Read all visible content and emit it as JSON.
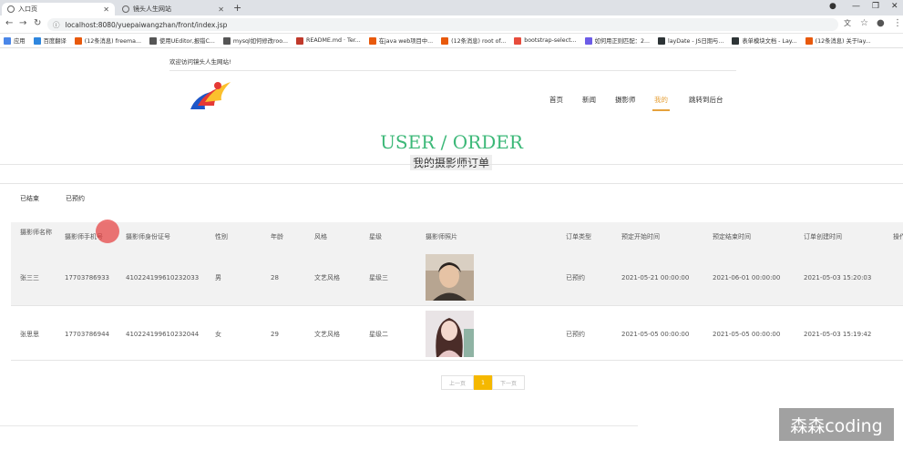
{
  "browser": {
    "tabs": [
      {
        "title": "入口页"
      },
      {
        "title": "镜头人生网站"
      }
    ],
    "new_tab": "+",
    "url": "localhost:8080/yuepaiwangzhan/front/index.jsp",
    "bookmarks": [
      "应用",
      "百度翻译",
      "(12条消息) freema...",
      "使用UEditor,报错C...",
      "mysql如何修改roo...",
      "README.md · Ter...",
      "在java web项目中...",
      "(12条消息) root of...",
      "bootstrap-select...",
      "如何用正则匹配：2...",
      "layDate - JS日期与...",
      "表单模块文档 - Lay...",
      "(12条消息) 关于lay..."
    ],
    "bookmark_colors": [
      "#4a86e8",
      "#2e86de",
      "#e8590c",
      "#555555",
      "#555555",
      "#c0392b",
      "#e8590c",
      "#e8590c",
      "#e74c3c",
      "#6c5ce7",
      "#2d3436",
      "#2d3436",
      "#e8590c"
    ]
  },
  "site": {
    "welcome": "欢迎访问镜头人生网站!",
    "nav": [
      "首页",
      "新闻",
      "摄影师",
      "我的",
      "跳转到后台"
    ],
    "active_nav": "我的",
    "title_en": "USER / ORDER",
    "title_cn": "我的摄影师订单",
    "filter_tabs": [
      "已结束",
      "已预约"
    ]
  },
  "table": {
    "headers": [
      "摄影师名称",
      "摄影师手机号",
      "摄影师身份证号",
      "性别",
      "年龄",
      "风格",
      "星级",
      "摄影师照片",
      "订单类型",
      "预定开始时间",
      "预定结束时间",
      "订单创建时间",
      "操作"
    ],
    "rows": [
      [
        "张三三",
        "17703786933",
        "410224199610232033",
        "男",
        "28",
        "文艺风格",
        "星级三",
        "",
        "已预约",
        "2021-05-21 00:00:00",
        "2021-06-01 00:00:00",
        "2021-05-03 15:20:03",
        ""
      ],
      [
        "张思思",
        "17703786944",
        "410224199610232044",
        "女",
        "29",
        "文艺风格",
        "星级二",
        "",
        "已预约",
        "2021-05-05 00:00:00",
        "2021-05-05 00:00:00",
        "2021-05-03 15:19:42",
        ""
      ]
    ]
  },
  "pager": {
    "prev": "上一页",
    "current": "1",
    "next": "下一页"
  },
  "watermark": "森森coding",
  "colors": {
    "title_green": "#3cb878",
    "accent": "#e6a23c",
    "pager_active": "#f5b800"
  }
}
